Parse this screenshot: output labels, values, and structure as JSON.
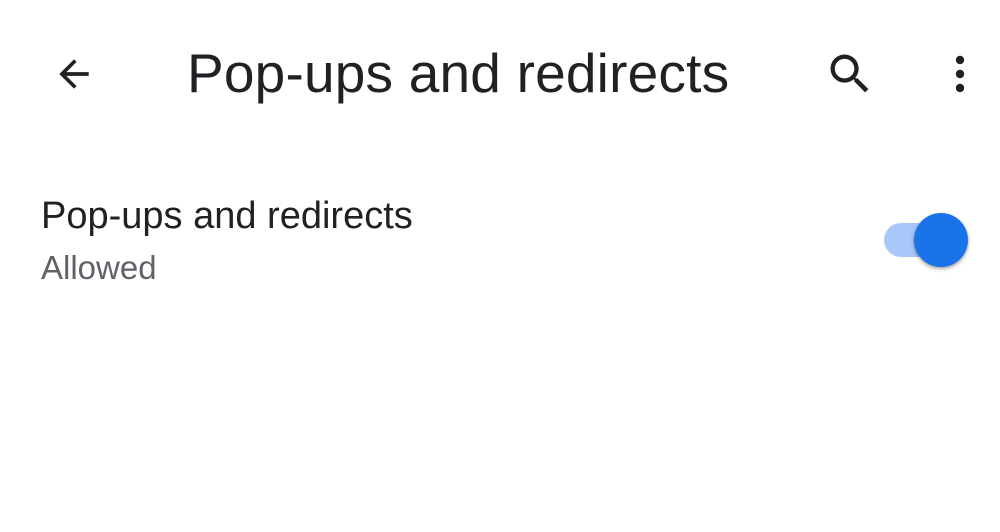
{
  "header": {
    "title": "Pop-ups and redirects",
    "back_icon": "arrow-back-icon",
    "search_icon": "search-icon",
    "more_icon": "more-vert-icon"
  },
  "setting": {
    "title": "Pop-ups and redirects",
    "summary": "Allowed",
    "toggle_on": true
  },
  "colors": {
    "text_primary": "#202124",
    "text_secondary": "#5f6368",
    "toggle_thumb": "#1a73e8",
    "toggle_track": "#a8c7fa",
    "icon": "#202124"
  }
}
